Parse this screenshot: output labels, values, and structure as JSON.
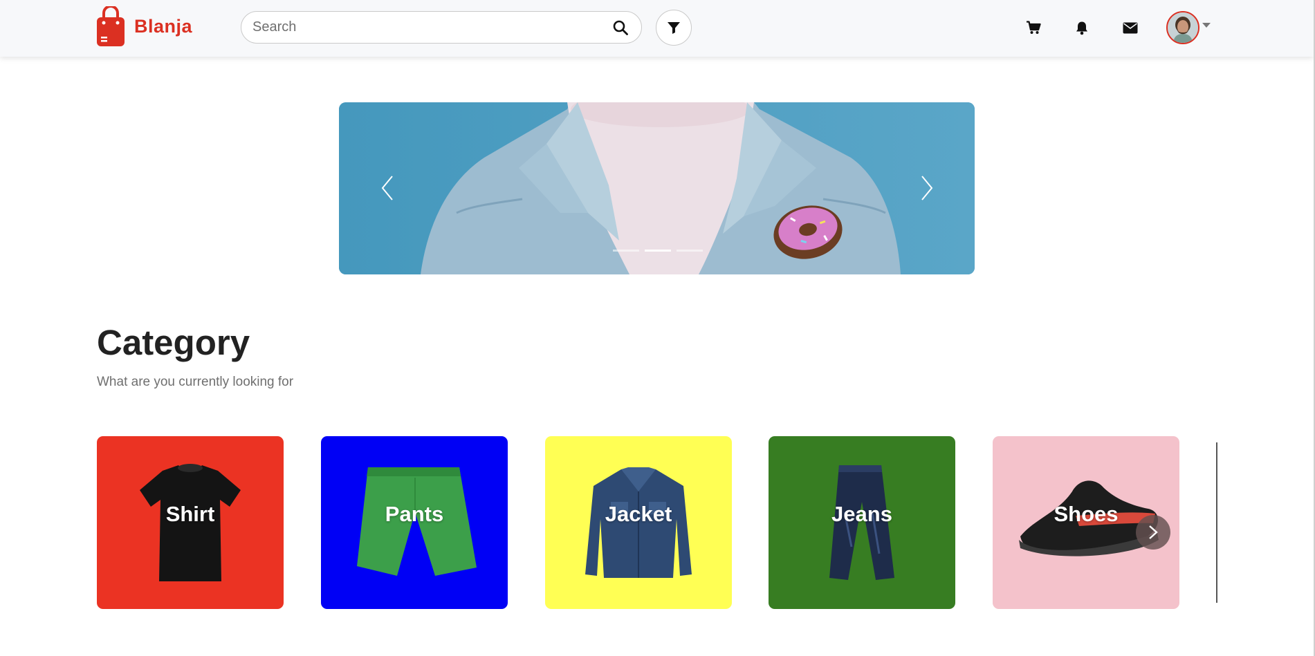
{
  "header": {
    "brand_name": "Blanja",
    "search_placeholder": "Search",
    "icons": [
      "cart-icon",
      "bell-icon",
      "mail-icon"
    ],
    "accent_color": "#db3022"
  },
  "carousel": {
    "slide_count": 3,
    "active_index": 1
  },
  "category": {
    "title": "Category",
    "subtitle": "What are you currently looking for",
    "items": [
      {
        "label": "Shirt",
        "color": "#eb3323"
      },
      {
        "label": "Pants",
        "color": "#0000f5"
      },
      {
        "label": "Jacket",
        "color": "#ffff54"
      },
      {
        "label": "Jeans",
        "color": "#377d22"
      },
      {
        "label": "Shoes",
        "color": "#f4c2cb"
      }
    ]
  }
}
